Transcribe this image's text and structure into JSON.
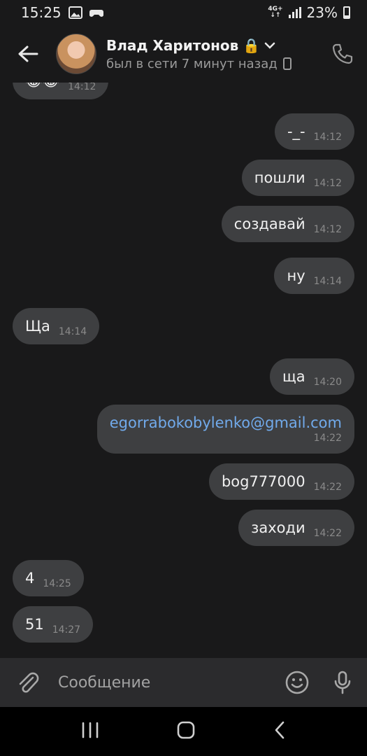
{
  "status_bar": {
    "time": "15:25",
    "network": "4G+",
    "battery": "23%"
  },
  "header": {
    "name": "Влад Харитонов",
    "name_emoji": "🔒",
    "status": "был в сети 7 минут назад"
  },
  "messages": [
    {
      "dir": "in",
      "text": "😂😂",
      "time": "14:12"
    },
    {
      "dir": "out",
      "text": "-_-",
      "time": "14:12"
    },
    {
      "dir": "out",
      "text": "пошли",
      "time": "14:12"
    },
    {
      "dir": "out",
      "text": "создавай",
      "time": "14:12"
    },
    {
      "dir": "out",
      "text": "ну",
      "time": "14:14"
    },
    {
      "dir": "in",
      "text": "Ща",
      "time": "14:14"
    },
    {
      "dir": "out",
      "text": "ща",
      "time": "14:20"
    },
    {
      "dir": "out",
      "text": "egorrabokobylenko@gmail.com",
      "time": "14:22",
      "link": true
    },
    {
      "dir": "out",
      "text": "bog777000",
      "time": "14:22"
    },
    {
      "dir": "out",
      "text": "заходи",
      "time": "14:22"
    },
    {
      "dir": "in",
      "text": "4",
      "time": "14:25"
    },
    {
      "dir": "in",
      "text": "51",
      "time": "14:27"
    }
  ],
  "composer": {
    "placeholder": "Сообщение"
  },
  "icons": {
    "back": "arrow-left-icon",
    "call": "phone-icon",
    "attach": "paperclip-icon",
    "emoji": "smiley-icon",
    "mic": "microphone-icon",
    "nav_recent": "recent-apps-icon",
    "nav_home": "home-icon",
    "nav_back": "chevron-left-icon"
  }
}
